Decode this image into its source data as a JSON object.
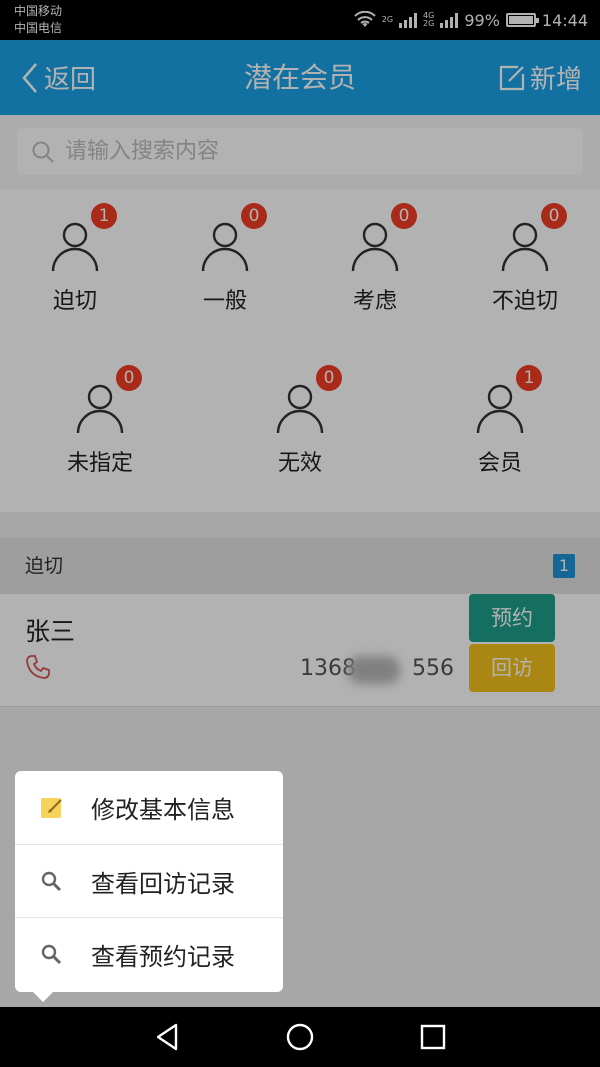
{
  "status_bar": {
    "carrier1": "中国移动",
    "carrier2": "中国电信",
    "net1": "2G",
    "net2": "4G",
    "net3": "2G",
    "battery": "99%",
    "battery_level": 0.99,
    "time": "14:44"
  },
  "header": {
    "back_label": "返回",
    "title": "潜在会员",
    "add_label": "新增",
    "bg_color": "#1aa3e7"
  },
  "search": {
    "placeholder": "请输入搜索内容"
  },
  "categories": [
    {
      "label": "迫切",
      "count": "1"
    },
    {
      "label": "一般",
      "count": "0"
    },
    {
      "label": "考虑",
      "count": "0"
    },
    {
      "label": "不迫切",
      "count": "0"
    },
    {
      "label": "未指定",
      "count": "0"
    },
    {
      "label": "无效",
      "count": "0"
    },
    {
      "label": "会员",
      "count": "1"
    }
  ],
  "section": {
    "title": "迫切",
    "count": "1"
  },
  "member": {
    "name": "张三",
    "phone_prefix": "1368",
    "phone_suffix": "556",
    "appoint_label": "预约",
    "revisit_label": "回访"
  },
  "popup_menu": {
    "items": [
      {
        "label": "修改基本信息",
        "icon": "edit-note-icon"
      },
      {
        "label": "查看回访记录",
        "icon": "magnifier-icon"
      },
      {
        "label": "查看预约记录",
        "icon": "magnifier-icon"
      }
    ]
  },
  "colors": {
    "badge": "#f23d23",
    "appoint": "#1ea08a",
    "revisit": "#f4c21c",
    "section_count": "#1d92d6"
  }
}
